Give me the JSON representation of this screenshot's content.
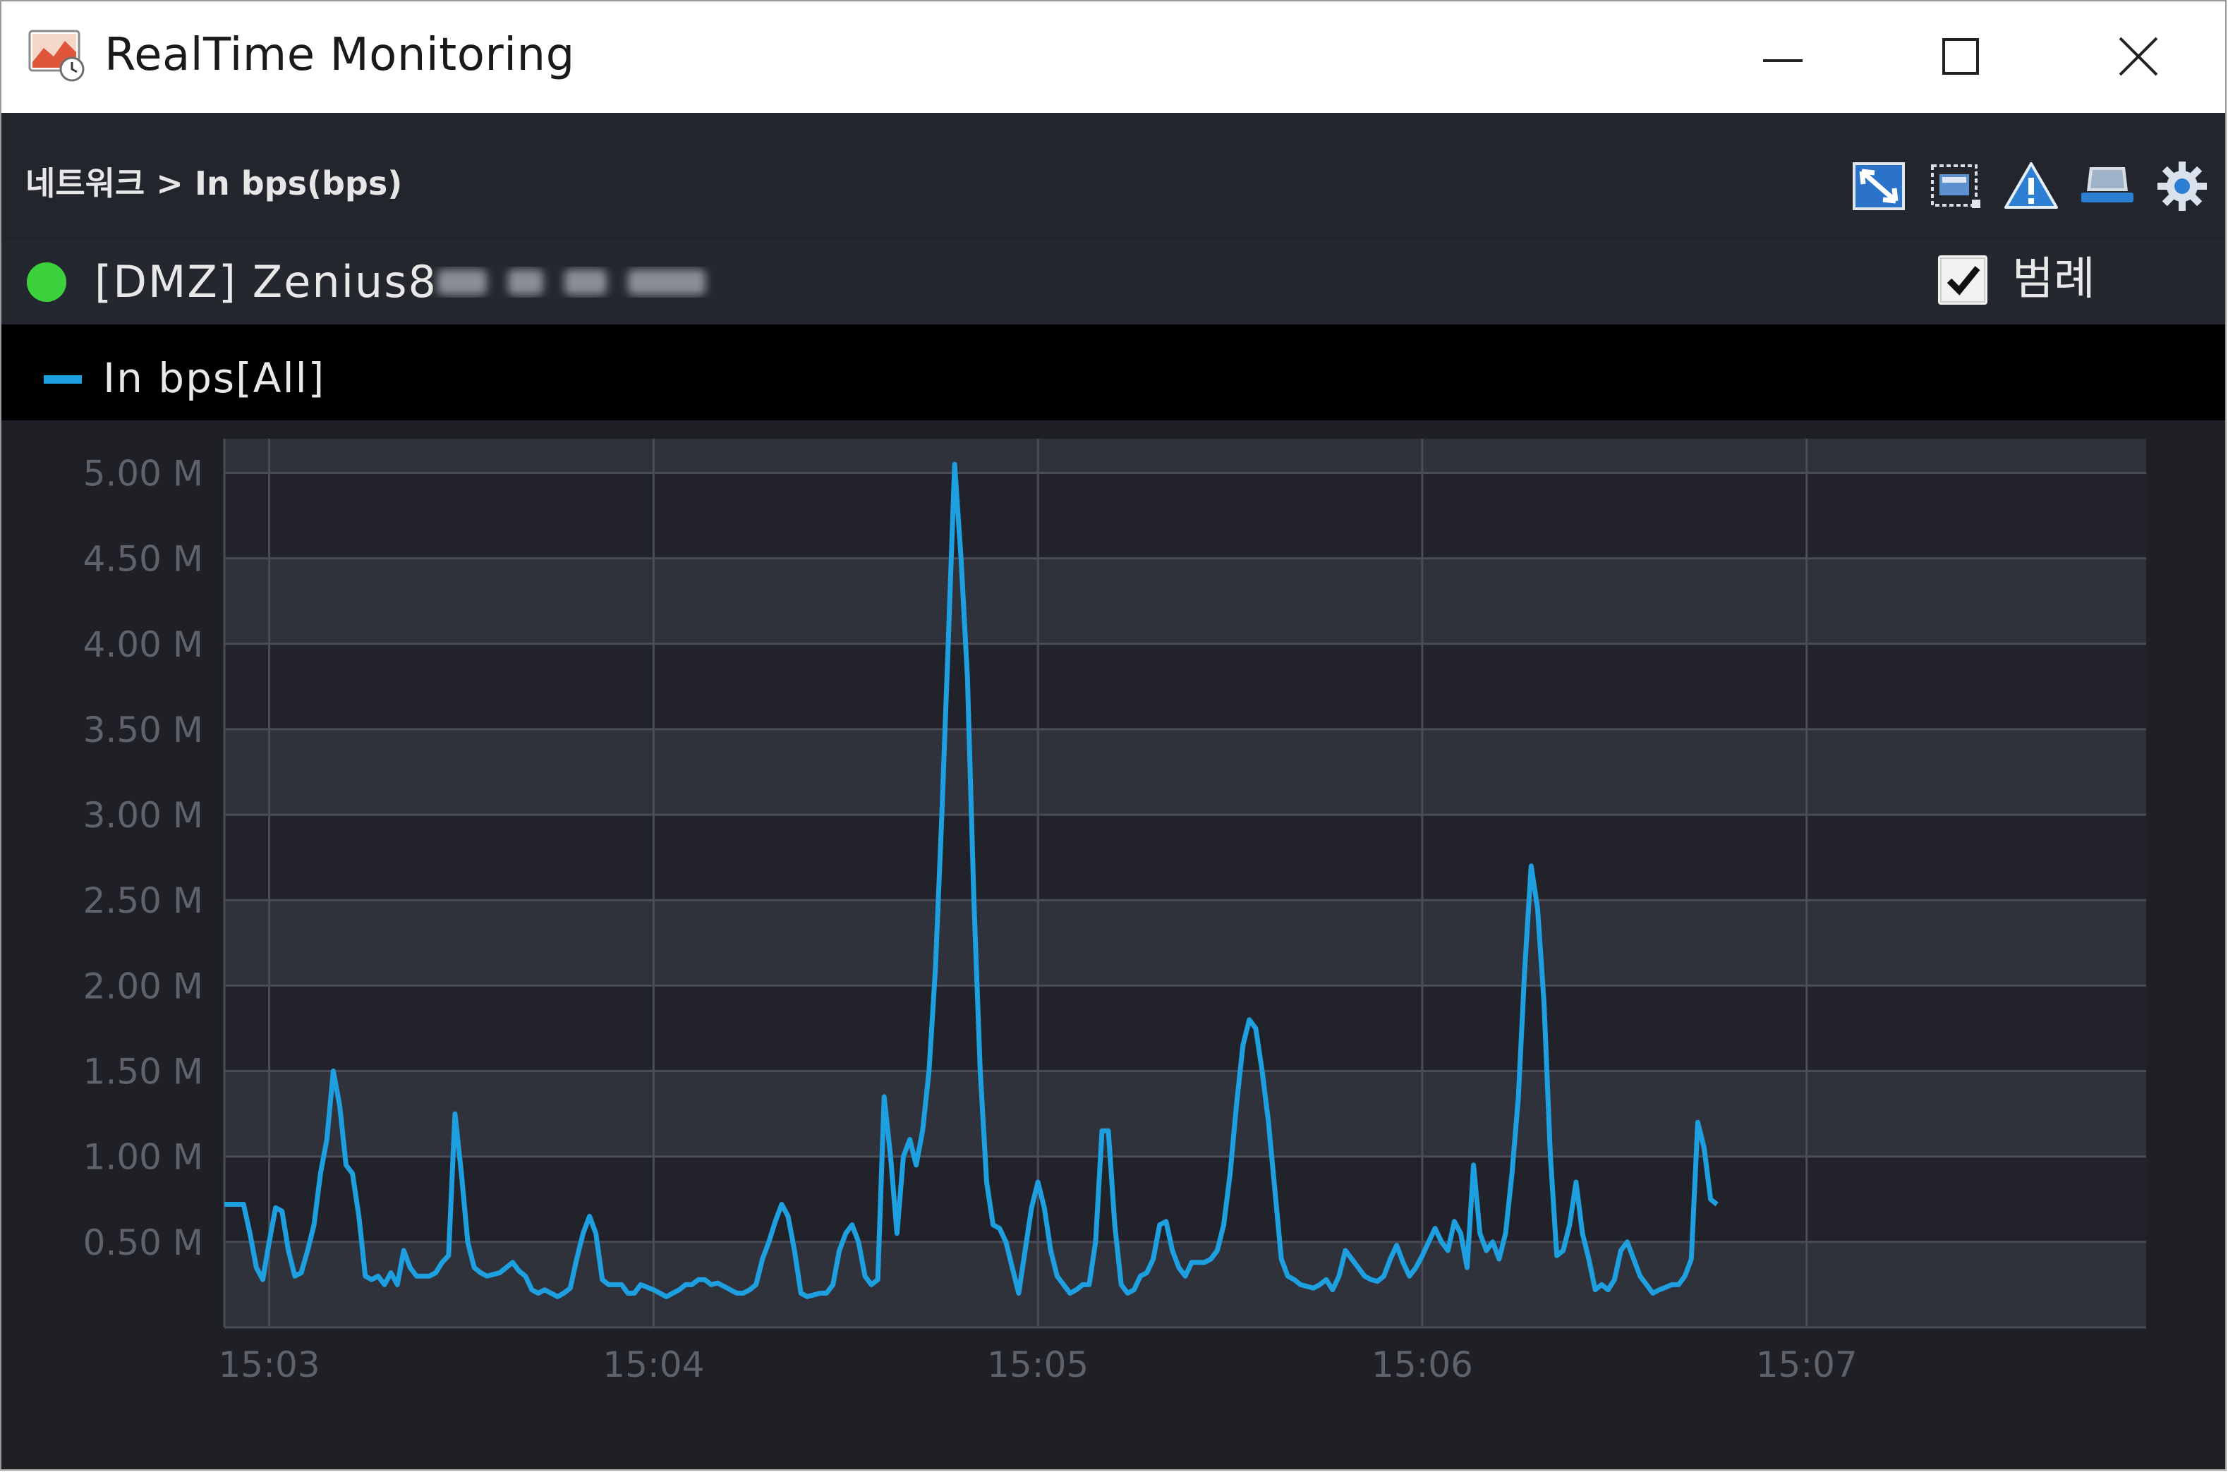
{
  "window": {
    "title": "RealTime Monitoring",
    "controls": [
      "minimize",
      "maximize",
      "close"
    ]
  },
  "toolbar": {
    "breadcrumb": "네트워크 > In bps(bps)",
    "icons": [
      "zoom-fit-icon",
      "select-area-icon",
      "alert-icon",
      "device-icon",
      "gear-icon"
    ]
  },
  "host": {
    "status_color": "#3dd13d",
    "name": "[DMZ] Zenius8"
  },
  "legend": {
    "checkbox_checked": true,
    "label": "범례"
  },
  "series_legend": {
    "label": "In bps[All]",
    "color": "#1e9fe0"
  },
  "chart_data": {
    "type": "line",
    "ylim": [
      0,
      5.2
    ],
    "yticks": [
      {
        "value": 0.5,
        "label": "0.50 M"
      },
      {
        "value": 1.0,
        "label": "1.00 M"
      },
      {
        "value": 1.5,
        "label": "1.50 M"
      },
      {
        "value": 2.0,
        "label": "2.00 M"
      },
      {
        "value": 2.5,
        "label": "2.50 M"
      },
      {
        "value": 3.0,
        "label": "3.00 M"
      },
      {
        "value": 3.5,
        "label": "3.50 M"
      },
      {
        "value": 4.0,
        "label": "4.00 M"
      },
      {
        "value": 4.5,
        "label": "4.50 M"
      },
      {
        "value": 5.0,
        "label": "5.00 M"
      }
    ],
    "xlim": [
      -7,
      293
    ],
    "xticks": [
      {
        "value": 0,
        "label": "15:03"
      },
      {
        "value": 60,
        "label": "15:04"
      },
      {
        "value": 120,
        "label": "15:05"
      },
      {
        "value": 180,
        "label": "15:06"
      },
      {
        "value": 240,
        "label": "15:07"
      }
    ],
    "series": [
      {
        "name": "In bps[All]",
        "color": "#1e9fe0",
        "points": [
          [
            -7,
            0.72
          ],
          [
            -4,
            0.72
          ],
          [
            -3,
            0.55
          ],
          [
            -2,
            0.35
          ],
          [
            -1,
            0.28
          ],
          [
            0,
            0.5
          ],
          [
            1,
            0.7
          ],
          [
            2,
            0.68
          ],
          [
            3,
            0.45
          ],
          [
            4,
            0.3
          ],
          [
            5,
            0.32
          ],
          [
            6,
            0.45
          ],
          [
            7,
            0.6
          ],
          [
            8,
            0.9
          ],
          [
            9,
            1.1
          ],
          [
            10,
            1.5
          ],
          [
            11,
            1.3
          ],
          [
            12,
            0.95
          ],
          [
            13,
            0.9
          ],
          [
            14,
            0.65
          ],
          [
            15,
            0.3
          ],
          [
            16,
            0.28
          ],
          [
            17,
            0.3
          ],
          [
            18,
            0.25
          ],
          [
            19,
            0.32
          ],
          [
            20,
            0.25
          ],
          [
            21,
            0.45
          ],
          [
            22,
            0.35
          ],
          [
            23,
            0.3
          ],
          [
            25,
            0.3
          ],
          [
            26,
            0.32
          ],
          [
            27,
            0.38
          ],
          [
            28,
            0.42
          ],
          [
            29,
            1.25
          ],
          [
            30,
            0.9
          ],
          [
            31,
            0.5
          ],
          [
            32,
            0.35
          ],
          [
            33,
            0.32
          ],
          [
            34,
            0.3
          ],
          [
            36,
            0.32
          ],
          [
            37,
            0.35
          ],
          [
            38,
            0.38
          ],
          [
            39,
            0.33
          ],
          [
            40,
            0.3
          ],
          [
            41,
            0.22
          ],
          [
            42,
            0.2
          ],
          [
            43,
            0.22
          ],
          [
            45,
            0.18
          ],
          [
            46,
            0.2
          ],
          [
            47,
            0.23
          ],
          [
            48,
            0.4
          ],
          [
            49,
            0.55
          ],
          [
            50,
            0.65
          ],
          [
            51,
            0.55
          ],
          [
            52,
            0.28
          ],
          [
            53,
            0.25
          ],
          [
            55,
            0.25
          ],
          [
            56,
            0.2
          ],
          [
            57,
            0.2
          ],
          [
            58,
            0.25
          ],
          [
            60,
            0.22
          ],
          [
            61,
            0.2
          ],
          [
            62,
            0.18
          ],
          [
            63,
            0.2
          ],
          [
            64,
            0.22
          ],
          [
            65,
            0.25
          ],
          [
            66,
            0.25
          ],
          [
            67,
            0.28
          ],
          [
            68,
            0.28
          ],
          [
            69,
            0.25
          ],
          [
            70,
            0.26
          ],
          [
            71,
            0.24
          ],
          [
            72,
            0.22
          ],
          [
            73,
            0.2
          ],
          [
            74,
            0.2
          ],
          [
            75,
            0.22
          ],
          [
            76,
            0.25
          ],
          [
            77,
            0.4
          ],
          [
            78,
            0.5
          ],
          [
            79,
            0.62
          ],
          [
            80,
            0.72
          ],
          [
            81,
            0.65
          ],
          [
            82,
            0.45
          ],
          [
            83,
            0.2
          ],
          [
            84,
            0.18
          ],
          [
            86,
            0.2
          ],
          [
            87,
            0.2
          ],
          [
            88,
            0.25
          ],
          [
            89,
            0.45
          ],
          [
            90,
            0.55
          ],
          [
            91,
            0.6
          ],
          [
            92,
            0.5
          ],
          [
            93,
            0.3
          ],
          [
            94,
            0.25
          ],
          [
            95,
            0.28
          ],
          [
            96,
            1.35
          ],
          [
            97,
            1.0
          ],
          [
            98,
            0.55
          ],
          [
            99,
            1.0
          ],
          [
            100,
            1.1
          ],
          [
            101,
            0.95
          ],
          [
            102,
            1.15
          ],
          [
            103,
            1.5
          ],
          [
            104,
            2.1
          ],
          [
            105,
            3.0
          ],
          [
            106,
            4.0
          ],
          [
            107,
            5.05
          ],
          [
            108,
            4.5
          ],
          [
            109,
            3.8
          ],
          [
            110,
            2.5
          ],
          [
            111,
            1.5
          ],
          [
            112,
            0.85
          ],
          [
            113,
            0.6
          ],
          [
            114,
            0.58
          ],
          [
            115,
            0.5
          ],
          [
            116,
            0.35
          ],
          [
            117,
            0.2
          ],
          [
            118,
            0.45
          ],
          [
            119,
            0.7
          ],
          [
            120,
            0.85
          ],
          [
            121,
            0.7
          ],
          [
            122,
            0.45
          ],
          [
            123,
            0.3
          ],
          [
            124,
            0.25
          ],
          [
            125,
            0.2
          ],
          [
            126,
            0.22
          ],
          [
            127,
            0.25
          ],
          [
            128,
            0.25
          ],
          [
            129,
            0.5
          ],
          [
            130,
            1.15
          ],
          [
            131,
            1.15
          ],
          [
            132,
            0.6
          ],
          [
            133,
            0.25
          ],
          [
            134,
            0.2
          ],
          [
            135,
            0.22
          ],
          [
            136,
            0.3
          ],
          [
            137,
            0.32
          ],
          [
            138,
            0.4
          ],
          [
            139,
            0.6
          ],
          [
            140,
            0.62
          ],
          [
            141,
            0.45
          ],
          [
            142,
            0.35
          ],
          [
            143,
            0.3
          ],
          [
            144,
            0.38
          ],
          [
            146,
            0.38
          ],
          [
            147,
            0.4
          ],
          [
            148,
            0.45
          ],
          [
            149,
            0.6
          ],
          [
            150,
            0.9
          ],
          [
            151,
            1.3
          ],
          [
            152,
            1.65
          ],
          [
            153,
            1.8
          ],
          [
            154,
            1.75
          ],
          [
            155,
            1.5
          ],
          [
            156,
            1.2
          ],
          [
            157,
            0.8
          ],
          [
            158,
            0.4
          ],
          [
            159,
            0.3
          ],
          [
            160,
            0.28
          ],
          [
            161,
            0.25
          ],
          [
            163,
            0.23
          ],
          [
            164,
            0.25
          ],
          [
            165,
            0.28
          ],
          [
            166,
            0.22
          ],
          [
            167,
            0.3
          ],
          [
            168,
            0.45
          ],
          [
            169,
            0.4
          ],
          [
            170,
            0.35
          ],
          [
            171,
            0.3
          ],
          [
            172,
            0.28
          ],
          [
            173,
            0.27
          ],
          [
            174,
            0.3
          ],
          [
            175,
            0.4
          ],
          [
            176,
            0.48
          ],
          [
            177,
            0.38
          ],
          [
            178,
            0.3
          ],
          [
            179,
            0.35
          ],
          [
            180,
            0.42
          ],
          [
            181,
            0.5
          ],
          [
            182,
            0.58
          ],
          [
            183,
            0.5
          ],
          [
            184,
            0.45
          ],
          [
            185,
            0.62
          ],
          [
            186,
            0.55
          ],
          [
            187,
            0.35
          ],
          [
            188,
            0.95
          ],
          [
            189,
            0.55
          ],
          [
            190,
            0.45
          ],
          [
            191,
            0.5
          ],
          [
            192,
            0.4
          ],
          [
            193,
            0.55
          ],
          [
            194,
            0.9
          ],
          [
            195,
            1.35
          ],
          [
            196,
            2.1
          ],
          [
            197,
            2.7
          ],
          [
            198,
            2.45
          ],
          [
            199,
            1.9
          ],
          [
            200,
            1.0
          ],
          [
            201,
            0.42
          ],
          [
            202,
            0.45
          ],
          [
            203,
            0.6
          ],
          [
            204,
            0.85
          ],
          [
            205,
            0.55
          ],
          [
            206,
            0.4
          ],
          [
            207,
            0.22
          ],
          [
            208,
            0.25
          ],
          [
            209,
            0.22
          ],
          [
            210,
            0.28
          ],
          [
            211,
            0.45
          ],
          [
            212,
            0.5
          ],
          [
            213,
            0.4
          ],
          [
            214,
            0.3
          ],
          [
            215,
            0.25
          ],
          [
            216,
            0.2
          ],
          [
            217,
            0.22
          ],
          [
            219,
            0.25
          ],
          [
            220,
            0.25
          ],
          [
            221,
            0.3
          ],
          [
            222,
            0.4
          ],
          [
            223,
            1.2
          ],
          [
            224,
            1.05
          ],
          [
            225,
            0.75
          ],
          [
            226,
            0.72
          ]
        ]
      }
    ]
  }
}
